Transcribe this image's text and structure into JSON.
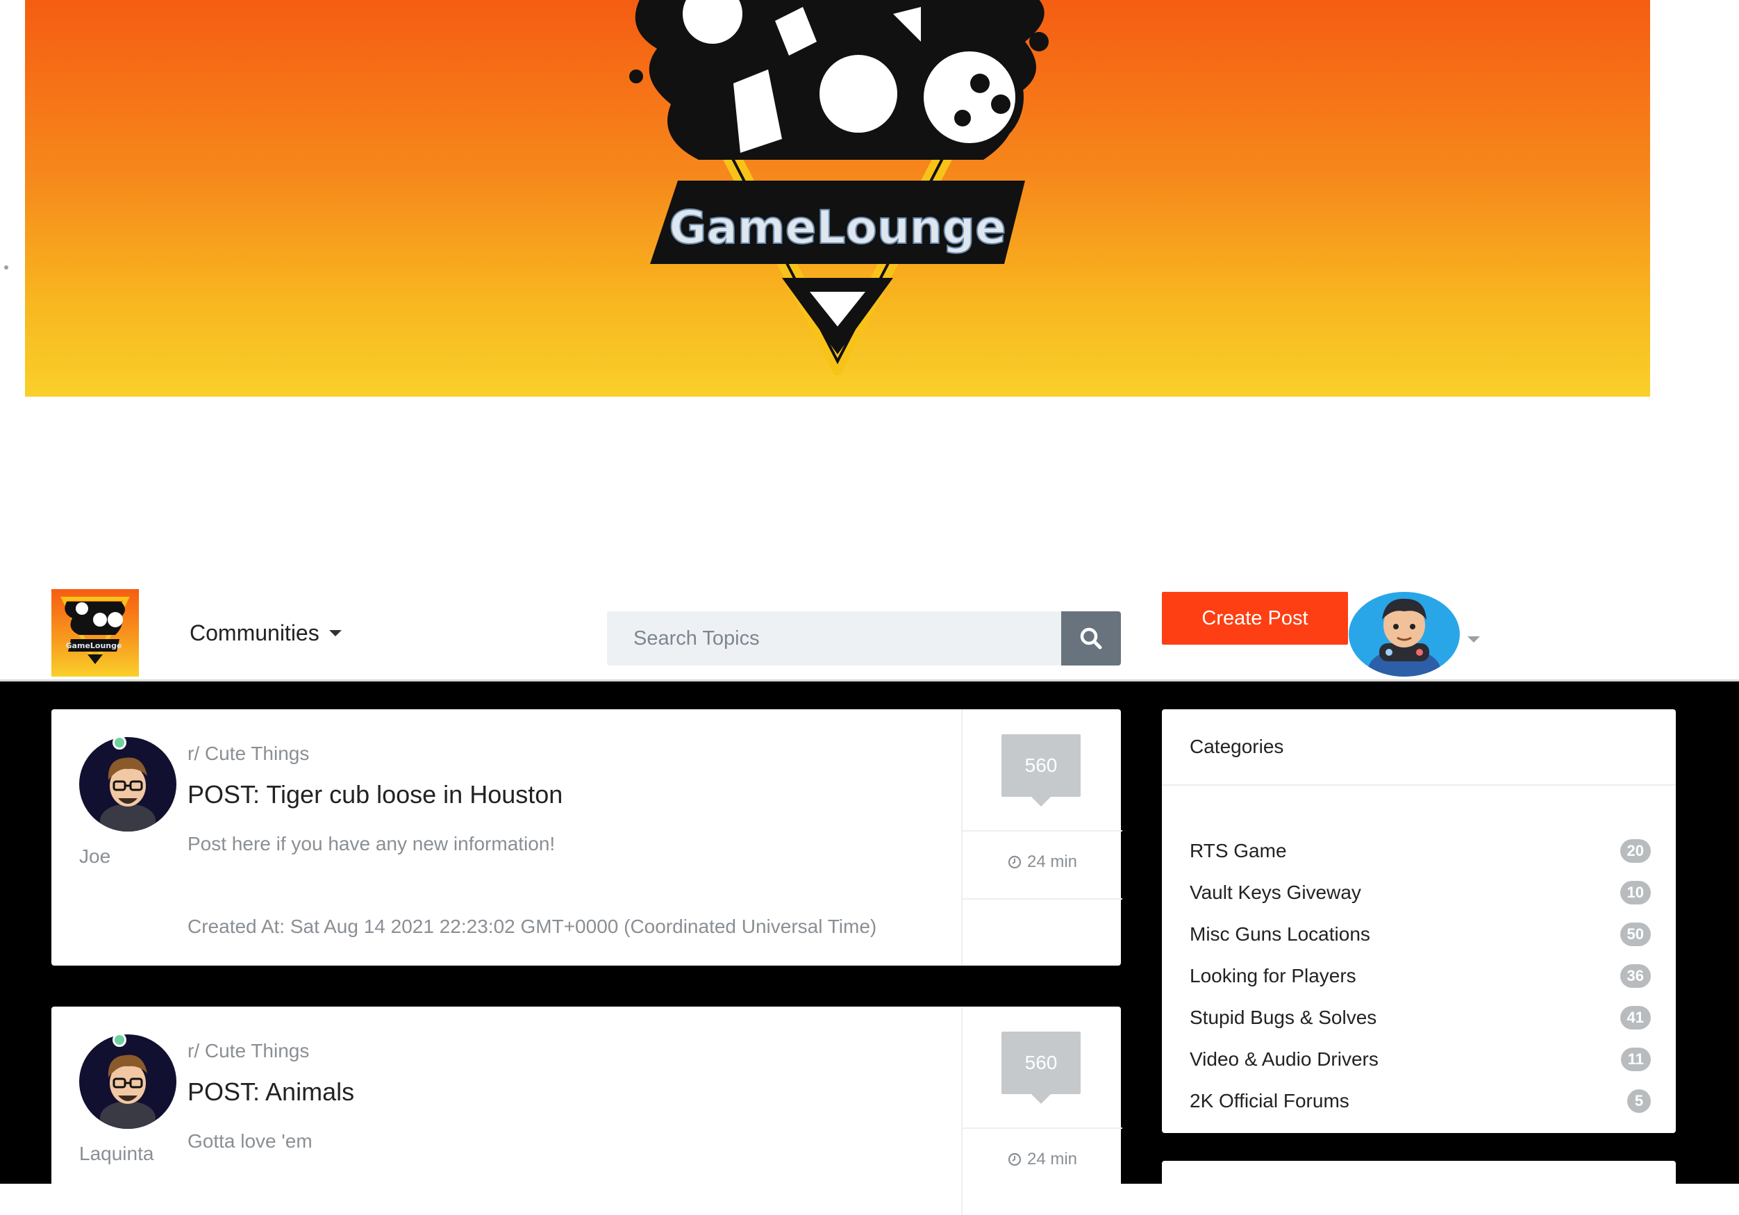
{
  "banner": {
    "brand": "GameLounge"
  },
  "navbar": {
    "communities_label": "Communities",
    "search_placeholder": "Search Topics",
    "create_post_label": "Create Post"
  },
  "posts": [
    {
      "community": "r/ Cute Things",
      "title": "POST: Tiger cub loose in Houston",
      "description": "Post here if you have any new information!",
      "created": "Created At: Sat Aug 14 2021 22:23:02 GMT+0000 (Coordinated Universal Time)",
      "username": "Joe",
      "count": "560",
      "time": "24 min"
    },
    {
      "community": "r/ Cute Things",
      "title": "POST: Animals",
      "description": "Gotta love 'em",
      "username": "Laquinta",
      "count": "560",
      "time": "24 min"
    }
  ],
  "categories": {
    "header": "Categories",
    "items": [
      {
        "name": "RTS Game",
        "count": "20"
      },
      {
        "name": "Vault Keys Giveway",
        "count": "10"
      },
      {
        "name": "Misc Guns Locations",
        "count": "50"
      },
      {
        "name": "Looking for Players",
        "count": "36"
      },
      {
        "name": "Stupid Bugs & Solves",
        "count": "41"
      },
      {
        "name": "Video & Audio Drivers",
        "count": "11"
      },
      {
        "name": "2K Official Forums",
        "count": "5"
      }
    ]
  },
  "colors": {
    "accent": "#fe3f13",
    "banner_top": "#f55d12",
    "banner_bottom": "#f9d02a",
    "search_button": "#69737d",
    "badge": "#b8bcbf"
  },
  "icons": {
    "search": "search-icon",
    "clock": "clock-icon",
    "caret": "chevron-down-icon"
  }
}
